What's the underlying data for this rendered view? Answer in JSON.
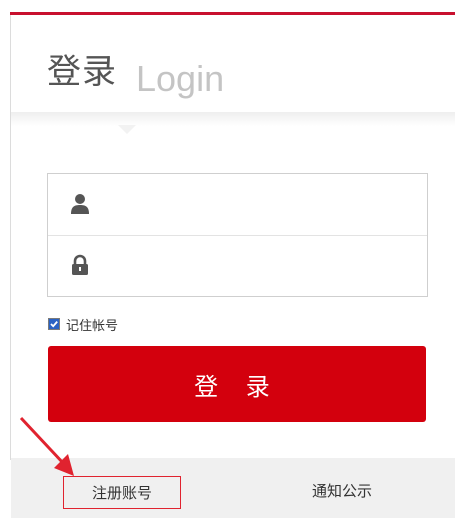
{
  "header": {
    "title_cn": "登录",
    "title_en": "Login"
  },
  "form": {
    "username": {
      "icon": "user-icon",
      "value": "",
      "placeholder": ""
    },
    "password": {
      "icon": "lock-icon",
      "value": "",
      "placeholder": ""
    },
    "remember": {
      "label": "记住帐号",
      "checked": true
    },
    "login_button": "登 录"
  },
  "footer": {
    "register": "注册账号",
    "notice": "通知公示"
  },
  "colors": {
    "accent": "#d3000d",
    "highlight_border": "#e0232f",
    "arrow": "#e0232f"
  }
}
